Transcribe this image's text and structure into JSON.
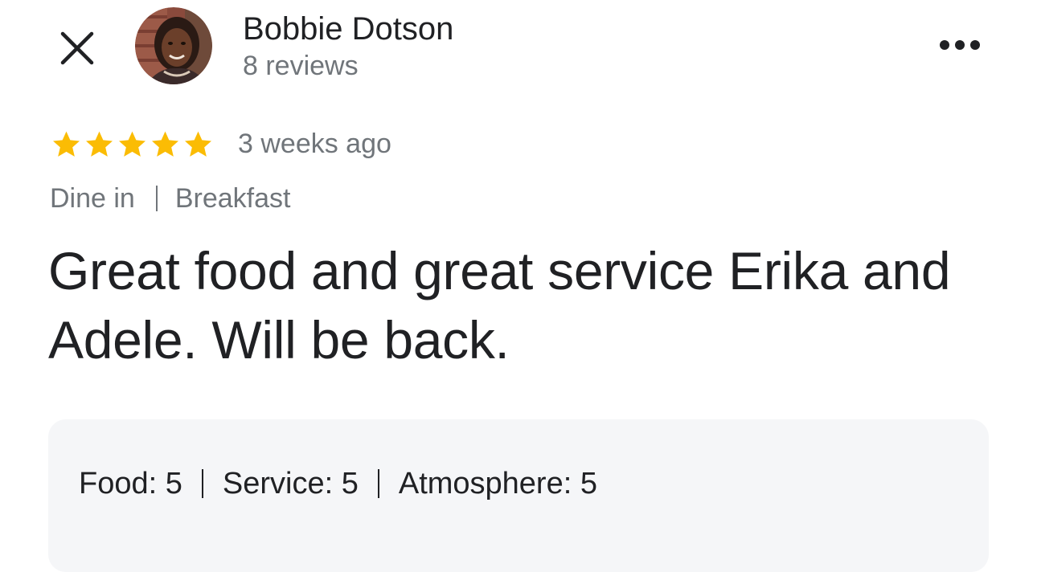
{
  "header": {
    "close_icon": "close-icon",
    "author_name": "Bobbie Dotson",
    "review_count": "8 reviews",
    "more_icon": "more-horizontal-icon"
  },
  "review": {
    "rating": 5,
    "rating_max": 5,
    "star_color": "#fbbc04",
    "time_ago": "3 weeks ago",
    "service_type": "Dine in",
    "meal_type": "Breakfast",
    "text": "Great food and great service Erika and Adele. Will be back."
  },
  "ratings": {
    "food": "Food: 5",
    "service": "Service: 5",
    "atmosphere": "Atmosphere: 5"
  },
  "colors": {
    "primary_text": "#202124",
    "secondary_text": "#70757a",
    "ratings_background": "#f5f6f8"
  }
}
